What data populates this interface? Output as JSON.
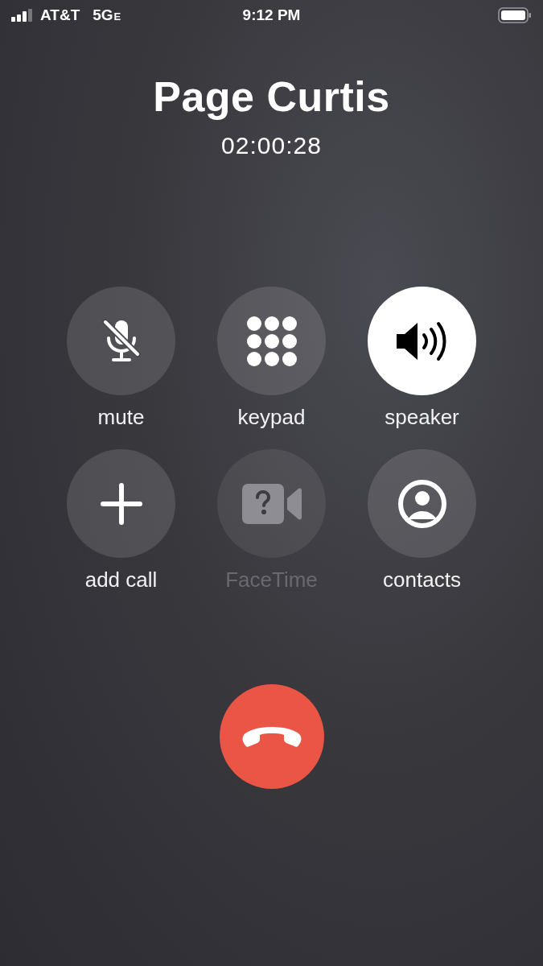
{
  "status_bar": {
    "carrier": "AT&T",
    "network": "5G",
    "network_suffix": "E",
    "time": "9:12 PM"
  },
  "call": {
    "name": "Page Curtis",
    "duration": "02:00:28"
  },
  "controls": [
    {
      "kind": "mute",
      "label": "mute",
      "selected": false,
      "disabled": false
    },
    {
      "kind": "keypad",
      "label": "keypad",
      "selected": false,
      "disabled": false
    },
    {
      "kind": "speaker",
      "label": "speaker",
      "selected": true,
      "disabled": false
    },
    {
      "kind": "add",
      "label": "add call",
      "selected": false,
      "disabled": false
    },
    {
      "kind": "facetime",
      "label": "FaceTime",
      "selected": false,
      "disabled": true
    },
    {
      "kind": "contacts",
      "label": "contacts",
      "selected": false,
      "disabled": false
    }
  ],
  "end_call": {
    "kind": "end"
  }
}
